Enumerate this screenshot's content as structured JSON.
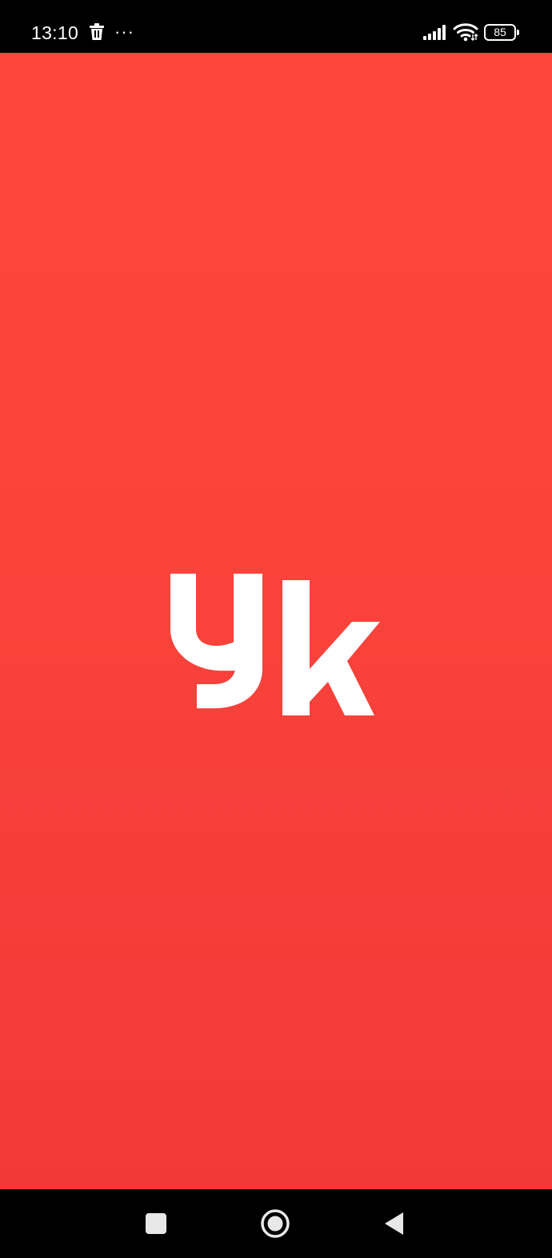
{
  "status_bar": {
    "time": "13:10",
    "more_indicator": "···",
    "battery_level": "85",
    "icons": [
      "trash-icon",
      "more-icon",
      "signal-icon",
      "wifi-icon",
      "battery-icon"
    ]
  },
  "splash": {
    "logo_text": "yk",
    "background_color": "#f9433b",
    "logo_color": "#ffffff"
  },
  "navigation_bar": {
    "buttons": [
      "recent-apps",
      "home",
      "back"
    ]
  }
}
